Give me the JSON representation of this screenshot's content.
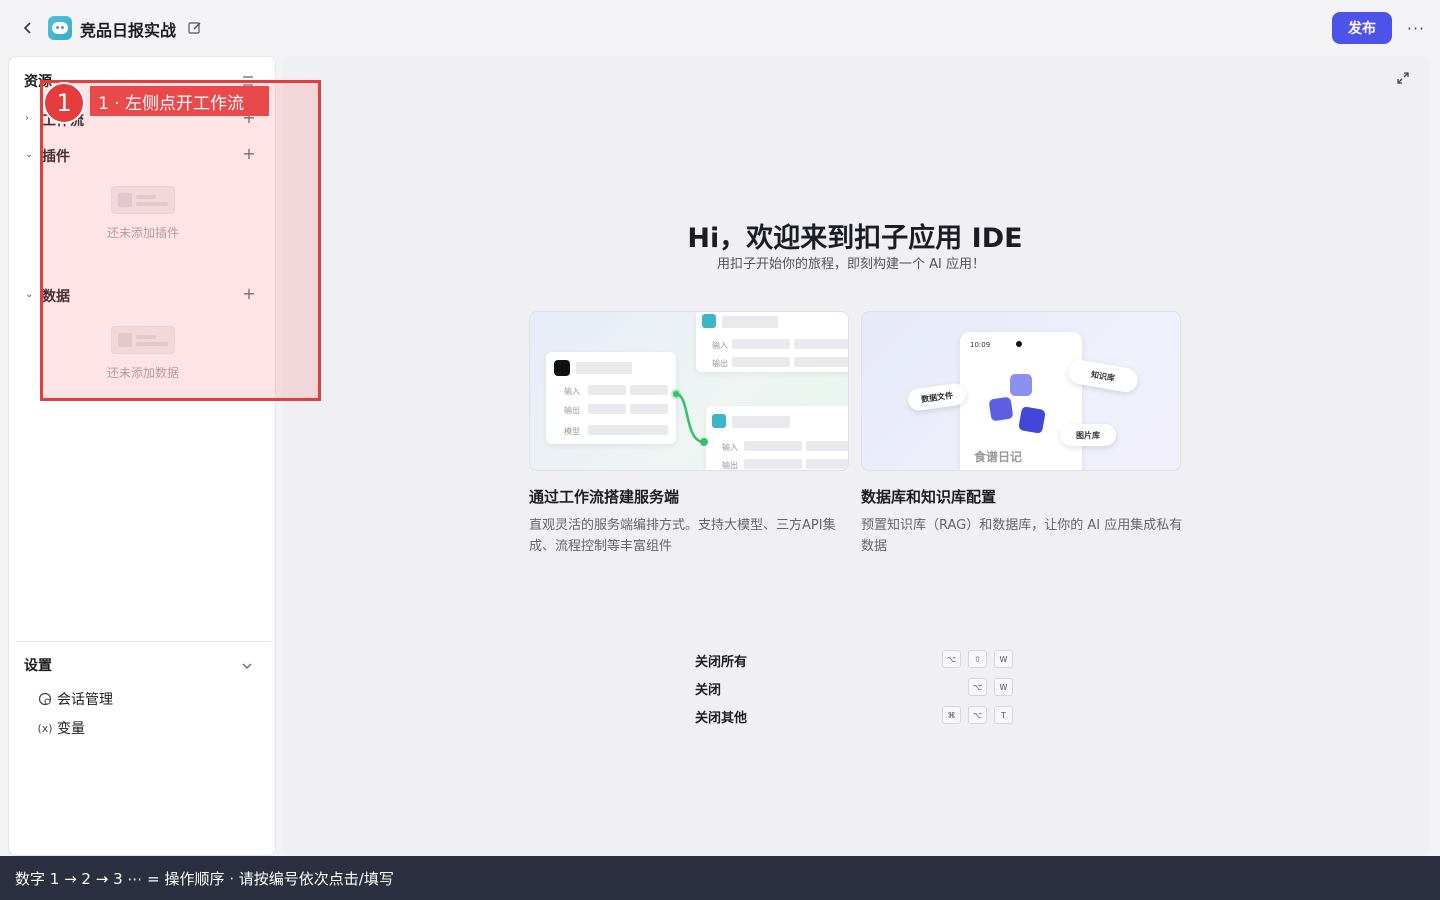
{
  "header": {
    "app_title": "竞品日报实战",
    "publish_label": "发布",
    "more_label": "···"
  },
  "sidebar": {
    "resources_title": "资源",
    "sections": [
      {
        "label": "工作流",
        "expanded": false
      },
      {
        "label": "插件",
        "expanded": true,
        "empty_text": "还未添加插件"
      },
      {
        "label": "数据",
        "expanded": true,
        "empty_text": "还未添加数据"
      }
    ],
    "settings": {
      "title": "设置",
      "items": [
        {
          "label": "会话管理",
          "icon": "conversation-icon"
        },
        {
          "label": "变量",
          "icon": "variable-icon",
          "icon_text": "(x)"
        }
      ]
    }
  },
  "annotation": {
    "number": "1",
    "text": "1 ·   左侧点开工作流"
  },
  "main": {
    "welcome_title": "Hi，欢迎来到扣子应用 IDE",
    "welcome_subtitle": "用扣子开始你的旅程，即刻构建一个 AI 应用！",
    "cards": [
      {
        "title": "通过工作流搭建服务端",
        "description": "直观灵活的服务端编排方式。支持大模型、三方API集成、流程控制等丰富组件",
        "labels": {
          "input": "输入",
          "output": "输出",
          "model": "模型"
        }
      },
      {
        "title": "数据库和知识库配置",
        "description": "预置知识库（RAG）和数据库，让你的 AI 应用集成私有数据",
        "labels": {
          "time": "10:09",
          "data_file": "数据文件",
          "knowledge": "知识库",
          "image_lib": "图片库",
          "recipe": "食谱日记"
        }
      }
    ],
    "shortcuts": [
      {
        "label": "关闭所有",
        "keys": [
          "⌥",
          "⇧",
          "W"
        ]
      },
      {
        "label": "关闭",
        "keys": [
          "⌥",
          "W"
        ]
      },
      {
        "label": "关闭其他",
        "keys": [
          "⌘",
          "⌥",
          "T"
        ]
      }
    ]
  },
  "footer": {
    "text": "数字 1 → 2 → 3 ⋯ = 操作顺序 ·   请按编号依次点击/填写"
  },
  "colors": {
    "accent": "#4d53e8",
    "annotation_red": "#e53d3d",
    "footer_bg": "#2b2f3f"
  }
}
